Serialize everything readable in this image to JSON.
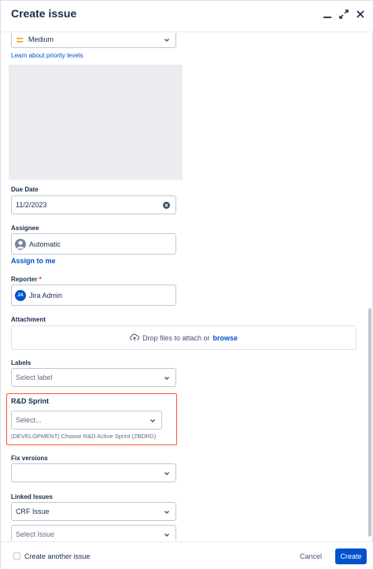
{
  "header": {
    "title": "Create issue"
  },
  "priority": {
    "value": "Medium",
    "learn_link": "Learn about priority levels",
    "color": "#ff991f"
  },
  "due_date": {
    "label": "Due Date",
    "value": "11/2/2023"
  },
  "assignee": {
    "label": "Assignee",
    "value": "Automatic",
    "assign_link": "Assign to me"
  },
  "reporter": {
    "label": "Reporter",
    "required_marker": "*",
    "value": "Jira Admin",
    "initials": "JA"
  },
  "attachment": {
    "label": "Attachment",
    "drop_text": "Drop files to attach or",
    "browse_text": "browse"
  },
  "labels": {
    "label": "Labels",
    "placeholder": "Select label"
  },
  "sprint": {
    "label": "R&D Sprint",
    "placeholder": "Select...",
    "helper": "(DEVELOPMENT) Choose R&D Active Sprint (ZBDRD)",
    "highlight_color": "#ff5630"
  },
  "fix_versions": {
    "label": "Fix versions",
    "value": ""
  },
  "linked_issues": {
    "label": "Linked Issues",
    "type_value": "CRF Issue",
    "issue_placeholder": "Select Issue"
  },
  "footer": {
    "create_another": "Create another issue",
    "cancel": "Cancel",
    "create": "Create"
  },
  "colors": {
    "primary": "#0052cc",
    "text": "#172b4d",
    "border": "#c1c7d0"
  }
}
